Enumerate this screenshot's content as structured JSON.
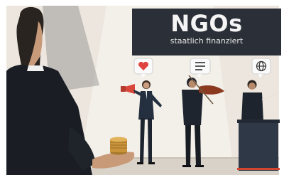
{
  "banner": {
    "title": "NGOs",
    "subtitle": "staatlich finanziert"
  },
  "bubbles": {
    "left_icon": "heart-icon",
    "middle_icon": "document-lines-icon",
    "right_icon": "globe-icon"
  },
  "colors": {
    "banner_bg": "#2b3038",
    "wall": "#efe9e1",
    "heart": "#e0433f",
    "megaphone": "#d9473b",
    "violin": "#8b3a1f",
    "suit_dark": "#1f252e",
    "coins": "#c9933a"
  }
}
